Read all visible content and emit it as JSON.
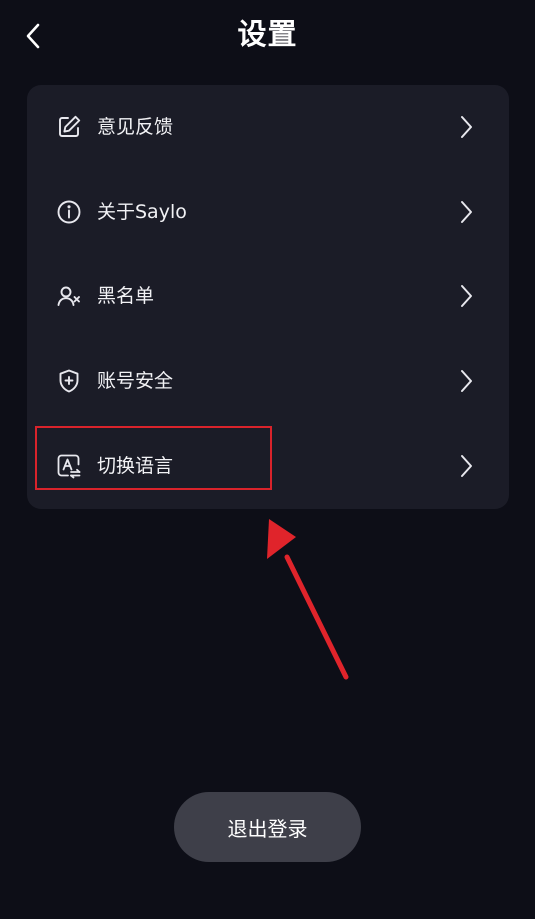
{
  "header": {
    "title": "设置",
    "back_icon": "chevron-left-icon"
  },
  "menu": {
    "items": [
      {
        "label": "意见反馈",
        "icon": "edit-feedback-icon"
      },
      {
        "label": "关于Saylo",
        "icon": "info-icon"
      },
      {
        "label": "黑名单",
        "icon": "user-block-icon"
      },
      {
        "label": "账号安全",
        "icon": "shield-plus-icon"
      },
      {
        "label": "切换语言",
        "icon": "language-switch-icon"
      }
    ],
    "chevron_icon": "chevron-right-icon"
  },
  "footer": {
    "logout_label": "退出登录"
  },
  "colors": {
    "background": "#0d0e17",
    "card": "#1b1c27",
    "button": "#3e3f49",
    "annotation": "#d9232b"
  }
}
